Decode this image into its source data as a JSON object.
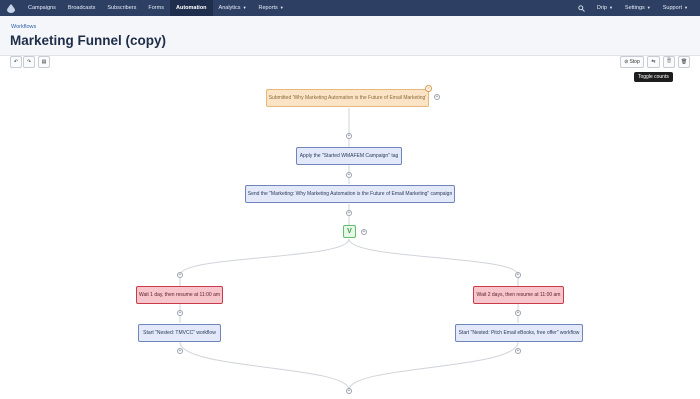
{
  "nav": {
    "items": [
      {
        "label": "Campaigns",
        "caret": false
      },
      {
        "label": "Broadcasts",
        "caret": false
      },
      {
        "label": "Subscribers",
        "caret": false
      },
      {
        "label": "Forms",
        "caret": false
      },
      {
        "label": "Automation",
        "caret": false,
        "active": true
      },
      {
        "label": "Analytics",
        "caret": true
      },
      {
        "label": "Reports",
        "caret": true
      }
    ],
    "right": [
      {
        "label": "Drip",
        "caret": true
      },
      {
        "label": "Settings",
        "caret": true
      },
      {
        "label": "Support",
        "caret": true
      }
    ],
    "caret_glyph": "▼"
  },
  "header": {
    "breadcrumb": "Workflows",
    "title": "Marketing Funnel (copy)"
  },
  "toolbar": {
    "undo_glyph": "↶",
    "redo_glyph": "↷",
    "book_glyph": "▤",
    "stop_label": "Stop",
    "stop_glyph": "⊘",
    "toggle_glyph": "⇋",
    "doc_glyph": "🗎",
    "trash_glyph": "🗑",
    "tooltip": "Toggle counts"
  },
  "workflow": {
    "trigger": "Submitted 'Why Marketing Automation is the Future of Email Marketing'",
    "apply_tag": "Apply the \"Started WMAFEM Campaign\" tag",
    "send_campaign": "Send the \"Marketing: Why Marketing Automation is the Future of Email Marketing\" campaign",
    "decision_glyph": "V",
    "wait_left": "Wait 1 day, then resume at 11:00 am",
    "wait_right": "Wait 2 days, then resume at 11:00 am",
    "start_left": "Start \"Nested: TMVCC\" workflow",
    "start_right": "Start \"Nested: Pitch Email eBooks, free offer\" workflow",
    "plus_glyph": "+",
    "close_glyph": "×"
  },
  "colors": {
    "nav_bg": "#2d3f63",
    "trigger_border": "#e7b878",
    "action_border": "#6f86bd",
    "wait_border": "#c93a4b",
    "decision_border": "#5fbf6a"
  }
}
